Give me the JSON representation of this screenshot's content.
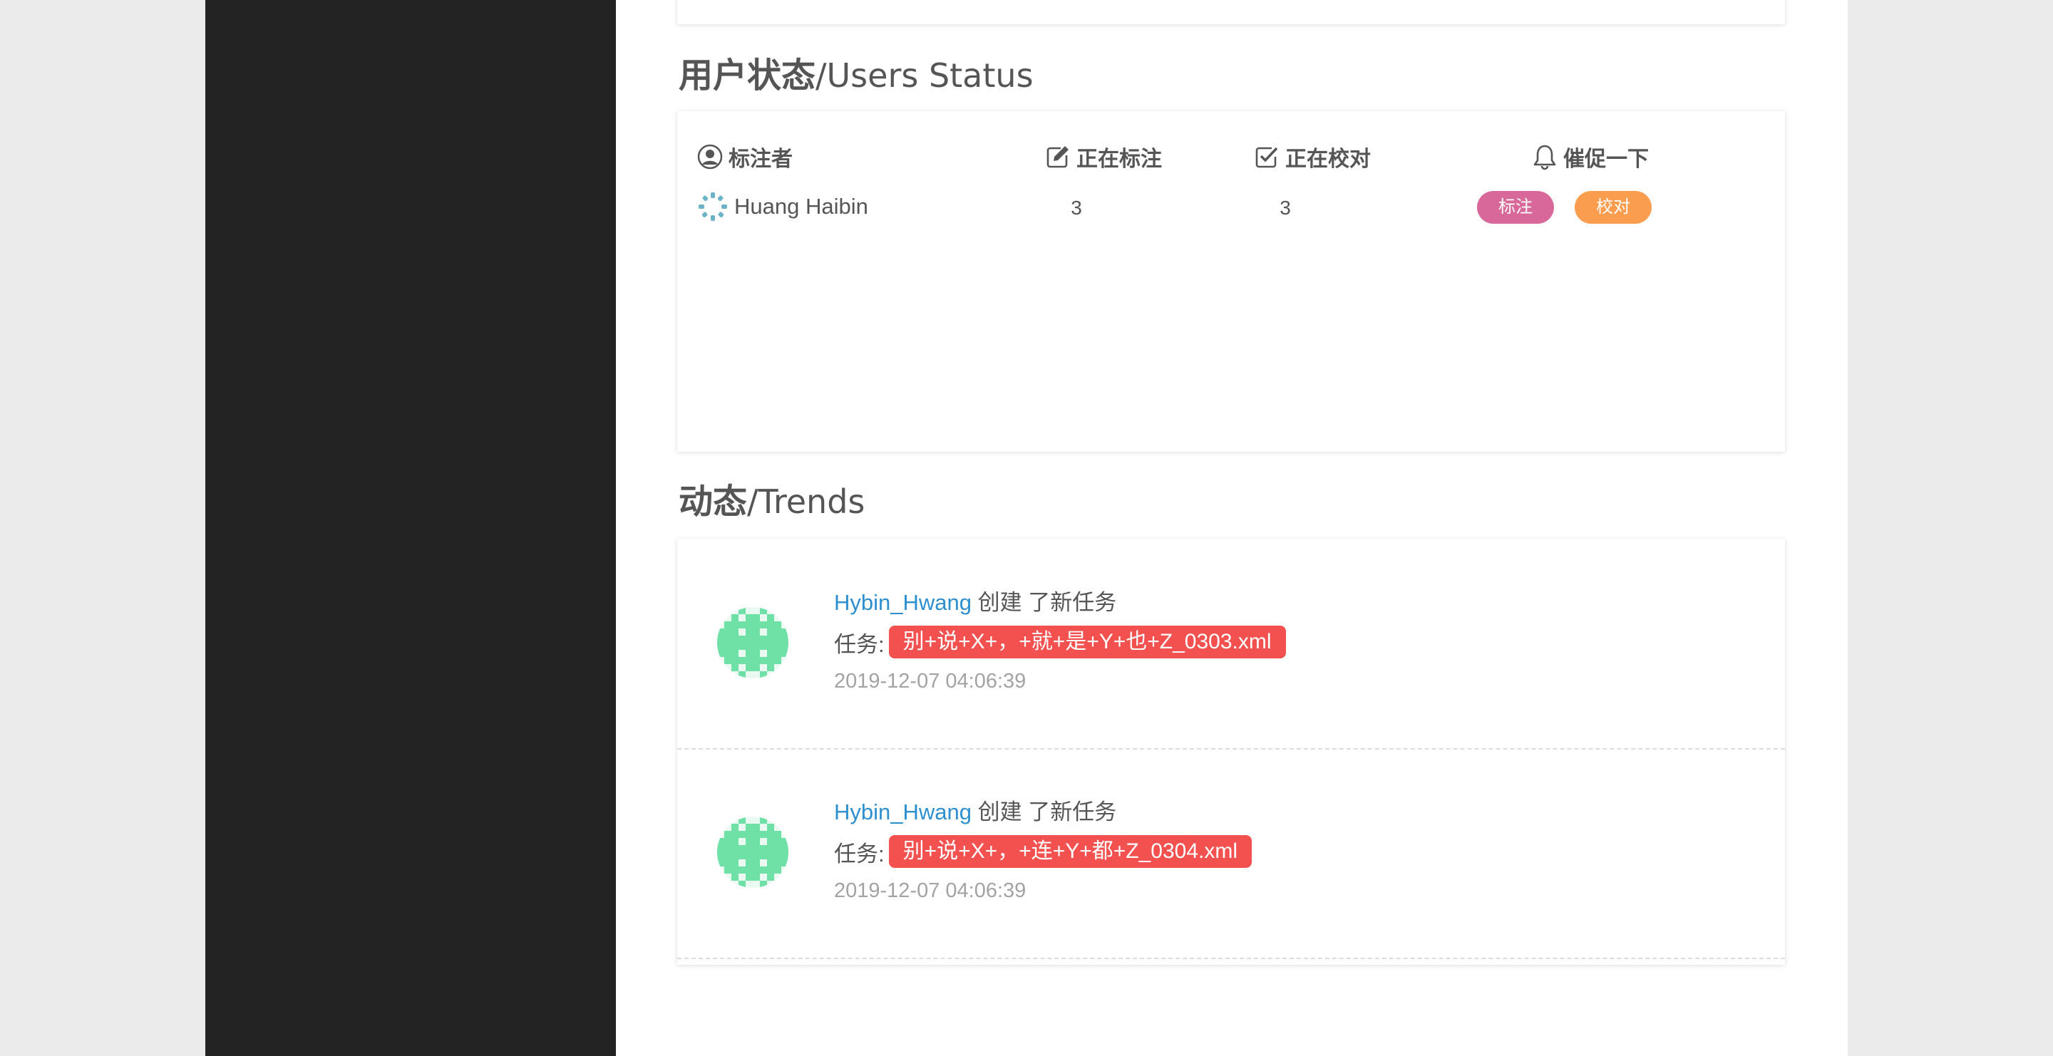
{
  "sections": {
    "users_status": {
      "title_zh": "用户状态",
      "title_en": "/Users Status",
      "columns": {
        "annotator": "标注者",
        "labeling": "正在标注",
        "checking": "正在校对",
        "remind": "催促一下"
      },
      "rows": [
        {
          "name": "Huang Haibin",
          "labeling_count": "3",
          "checking_count": "3",
          "remind_label_button": "标注",
          "remind_check_button": "校对"
        }
      ]
    },
    "trends": {
      "title_zh": "动态",
      "title_en": "/Trends",
      "items": [
        {
          "user": "Hybin_Hwang",
          "action": " 创建 了新任务",
          "task_prefix": "任务:",
          "task_name": "别+说+X+，+就+是+Y+也+Z_0303.xml",
          "time": "2019-12-07 04:06:39"
        },
        {
          "user": "Hybin_Hwang",
          "action": " 创建 了新任务",
          "task_prefix": "任务:",
          "task_name": "别+说+X+，+连+Y+都+Z_0304.xml",
          "time": "2019-12-07 04:06:39"
        }
      ]
    }
  },
  "colors": {
    "sidebar": "#232323",
    "background": "#ebebeb",
    "link": "#2e8fcf",
    "task_tag": "#f35050",
    "remind_label": "#d9689a",
    "remind_check": "#fb9d4e",
    "avatar_green": "#6fe0a6"
  },
  "icons": {
    "annotator": "user-circle-icon",
    "labeling": "edit-icon",
    "checking": "check-square-icon",
    "remind": "bell-icon"
  }
}
